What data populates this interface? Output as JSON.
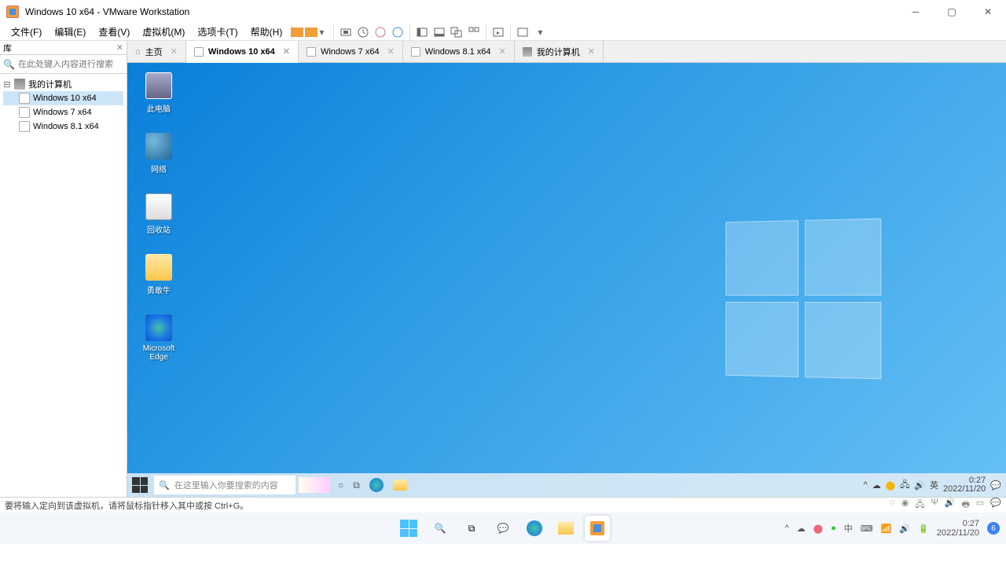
{
  "window": {
    "title": "Windows 10 x64 - VMware Workstation"
  },
  "menu": {
    "file": "文件(F)",
    "edit": "编辑(E)",
    "view": "查看(V)",
    "vm": "虚拟机(M)",
    "tabs": "选项卡(T)",
    "help": "帮助(H)"
  },
  "sidebar": {
    "lib_title": "库",
    "search_placeholder": "在此处键入内容进行搜索",
    "root": "我的计算机",
    "vms": [
      "Windows 10 x64",
      "Windows 7 x64",
      "Windows 8.1 x64"
    ]
  },
  "tabs": [
    {
      "label": "主页",
      "type": "home"
    },
    {
      "label": "Windows 10 x64",
      "type": "vm",
      "active": true
    },
    {
      "label": "Windows 7 x64",
      "type": "vm"
    },
    {
      "label": "Windows 8.1 x64",
      "type": "vm"
    },
    {
      "label": "我的计算机",
      "type": "comp"
    }
  ],
  "guest": {
    "icons": {
      "pc": "此电脑",
      "net": "网络",
      "bin": "回收站",
      "user": "勇敢牛",
      "edge1": "Microsoft",
      "edge2": "Edge"
    },
    "search_placeholder": "在这里输入你要搜索的内容",
    "tray": {
      "ime": "英",
      "time": "0:27",
      "date": "2022/11/20"
    }
  },
  "status": {
    "hint": "要将输入定向到该虚拟机，请将鼠标指针移入其中或按 Ctrl+G。"
  },
  "host": {
    "tray": {
      "ime": "中",
      "time": "0:27",
      "date": "2022/11/20",
      "badge": "6"
    }
  }
}
